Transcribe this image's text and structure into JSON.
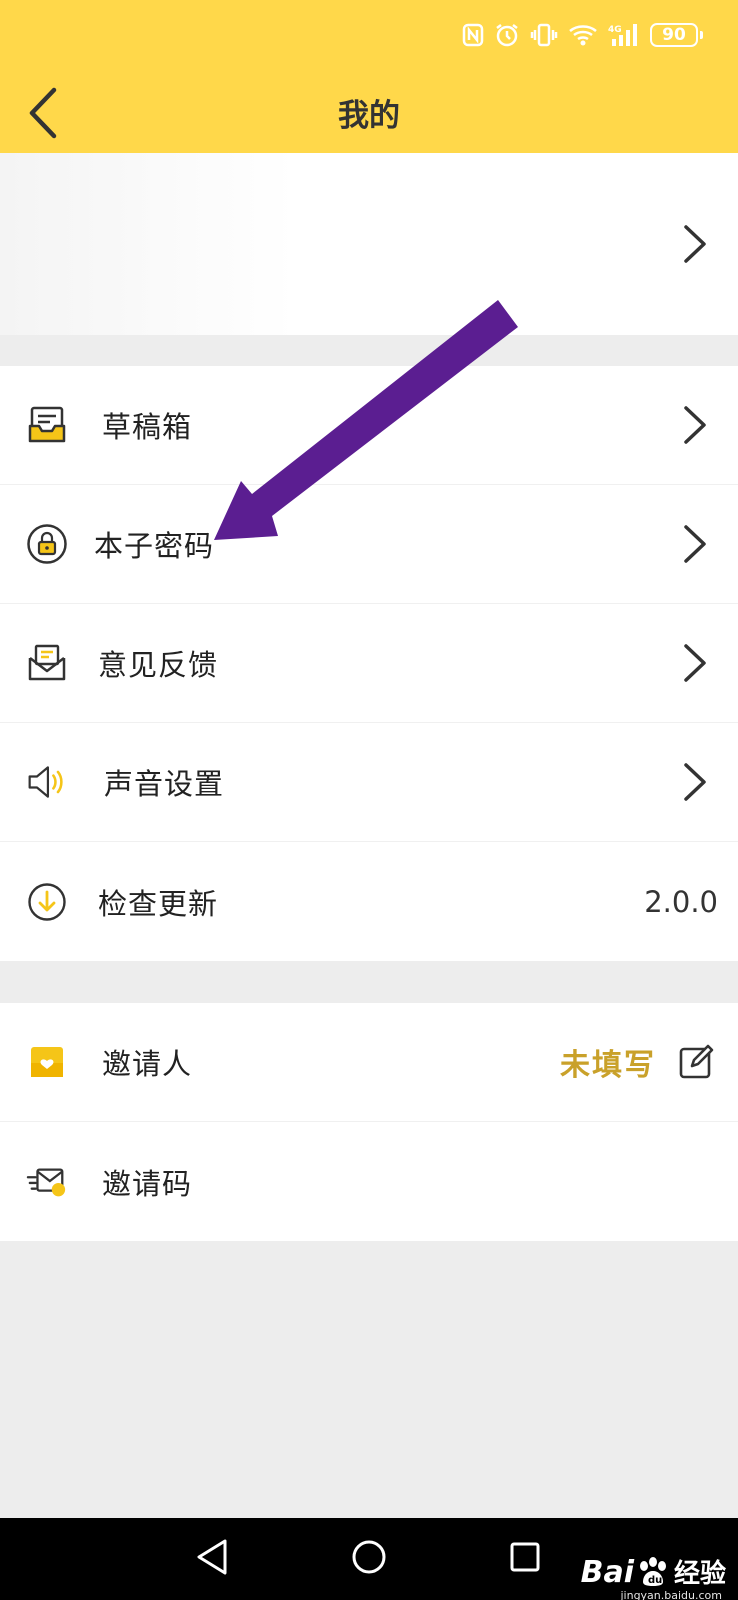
{
  "header": {
    "title": "我的",
    "battery": "90"
  },
  "menu_primary": [
    {
      "label": "草稿箱",
      "icon": "drafts-icon"
    },
    {
      "label": "本子密码",
      "icon": "lock-icon"
    },
    {
      "label": "意见反馈",
      "icon": "feedback-envelope-icon"
    },
    {
      "label": "声音设置",
      "icon": "speaker-icon"
    },
    {
      "label": "检查更新",
      "icon": "download-circle-icon",
      "value": "2.0.0"
    }
  ],
  "menu_secondary": [
    {
      "label": "邀请人",
      "icon": "inviter-icon",
      "value": "未填写"
    },
    {
      "label": "邀请码",
      "icon": "invite-code-icon"
    }
  ],
  "watermark": {
    "brand": "Bai",
    "brand_tail": "经验",
    "url": "jingyan.baidu.com"
  },
  "colors": {
    "header_bg": "#ffd84a",
    "accent_gold": "#c9a12a",
    "annotation_arrow": "#5b1e91"
  }
}
